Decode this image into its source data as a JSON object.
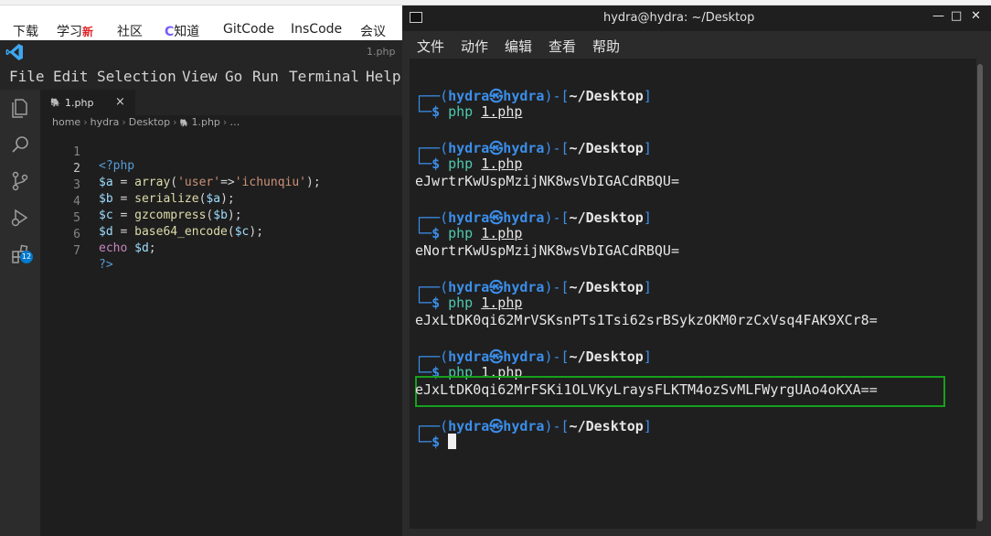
{
  "browser": {
    "bookmarks": [
      {
        "label": "下载"
      },
      {
        "label": "学习",
        "badge": "新"
      },
      {
        "label": "社区"
      },
      {
        "label": "知道",
        "icon": "ring-logo-icon"
      },
      {
        "label": "GitCode"
      },
      {
        "label": "InsCode"
      },
      {
        "label": "会议"
      }
    ]
  },
  "vscode": {
    "title": "1.php",
    "menu": [
      "File",
      "Edit",
      "Selection",
      "View",
      "Go",
      "Run",
      "Terminal",
      "Help"
    ],
    "activity_icons": [
      "explorer-icon",
      "search-icon",
      "source-control-icon",
      "run-debug-icon",
      "extensions-icon"
    ],
    "extensions_badge": "12",
    "tab": {
      "icon": "php-elephant-icon",
      "label": "1.php",
      "close": "×"
    },
    "breadcrumb": [
      "home",
      "hydra",
      "Desktop",
      "1.php",
      "…"
    ],
    "code_lines": [
      {
        "n": "1",
        "text": "<?php"
      },
      {
        "n": "2",
        "text": "$a = array('user'=>'ichunqiu');"
      },
      {
        "n": "3",
        "text": "$b = serialize($a);"
      },
      {
        "n": "4",
        "text": "$c = gzcompress($b);"
      },
      {
        "n": "5",
        "text": "$d = base64_encode($c);"
      },
      {
        "n": "6",
        "text": "echo $d;"
      },
      {
        "n": "7",
        "text": "?>"
      }
    ],
    "current_line": 2
  },
  "terminal": {
    "title": "hydra@hydra: ~/Desktop",
    "controls": [
      "—",
      "□",
      "✕"
    ],
    "menu": [
      "文件",
      "动作",
      "编辑",
      "查看",
      "帮助"
    ],
    "prompt": {
      "user": "hydra",
      "at": "㉿",
      "host": "hydra",
      "dir": "~/Desktop",
      "symbol": "$"
    },
    "sessions": [
      {
        "command": "php",
        "arg": "1.php",
        "output": ""
      },
      {
        "command": "php",
        "arg": "1.php",
        "output": "eJwrtrKwUspMzijNK8wsVbIGACdRBQU="
      },
      {
        "command": "php",
        "arg": "1.php",
        "output": "eNortrKwUspMzijNK8wsVbIGACdRBQU="
      },
      {
        "command": "php",
        "arg": "1.php",
        "output": "eJxLtDK0qi62MrVSKsnPTs1Tsi62srBSykzOKM0rzCxVsq4FAK9XCr8="
      },
      {
        "command": "php",
        "arg": "1.php",
        "output": "eJxLtDK0qi62MrFSKi1OLVKyLraysFLKTM4ozSvMLFWyrgUAo4oKXA=="
      }
    ],
    "highlighted_output_index": 4
  }
}
